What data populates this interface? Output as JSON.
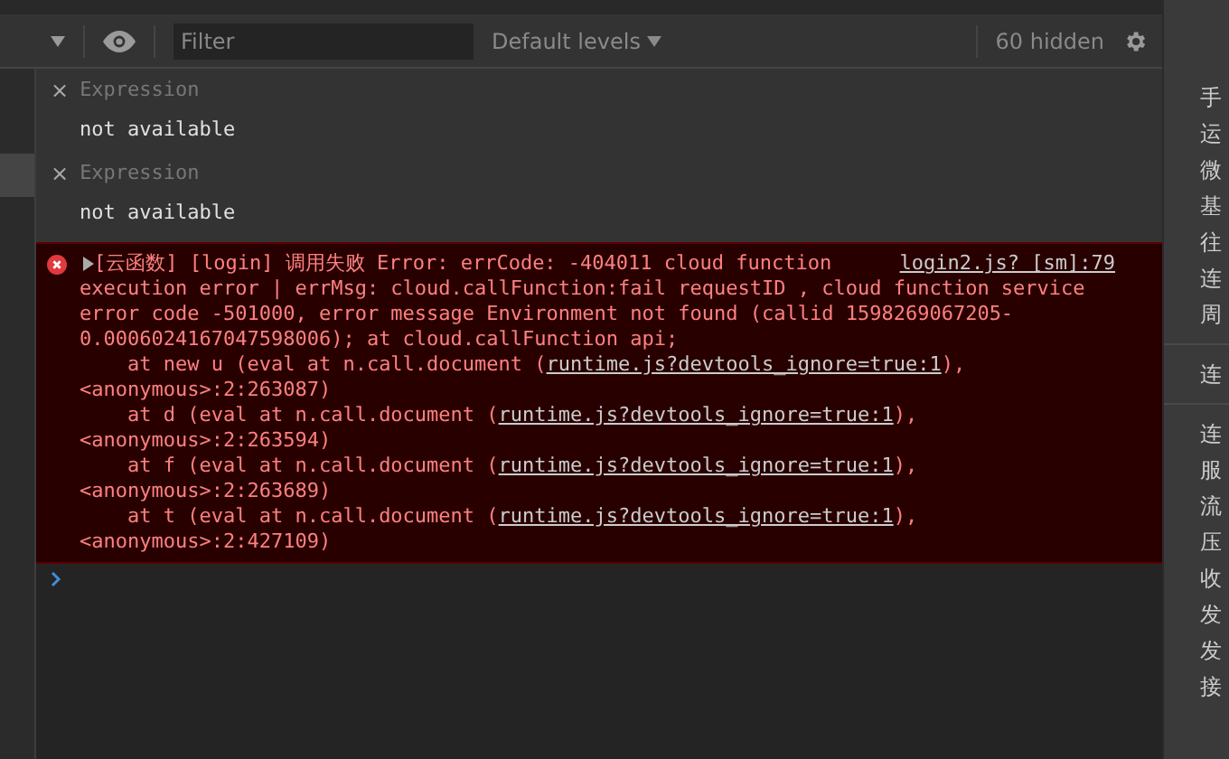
{
  "toolbar": {
    "filter": {
      "placeholder": "Filter"
    },
    "levels": "Default levels",
    "hidden_count": "60 hidden"
  },
  "expressions": [
    {
      "close": "×",
      "label": "Expression",
      "value": "not available"
    },
    {
      "close": "×",
      "label": "Expression",
      "value": "not available"
    }
  ],
  "error": {
    "expanded": false,
    "source": "login2.js? [sm]:79",
    "lines": [
      [
        {
          "text": "[云函数] [login] 调用失败 Error: errCode: -404011 cloud function",
          "link": false
        }
      ],
      [
        {
          "text": "execution error | errMsg: cloud.callFunction:fail requestID , cloud function service",
          "link": false
        }
      ],
      [
        {
          "text": "error code -501000, error message Environment not found (callid 1598269067205-",
          "link": false
        }
      ],
      [
        {
          "text": "0.0006024167047598006); at cloud.callFunction api;",
          "link": false
        }
      ],
      [
        {
          "text": "    at new u (eval at n.call.document (",
          "link": false
        },
        {
          "text": "runtime.js?devtools_ignore=true:1",
          "link": true
        },
        {
          "text": "),",
          "link": false
        }
      ],
      [
        {
          "text": "<anonymous>:2:263087)",
          "link": false
        }
      ],
      [
        {
          "text": "    at d (eval at n.call.document (",
          "link": false
        },
        {
          "text": "runtime.js?devtools_ignore=true:1",
          "link": true
        },
        {
          "text": "),",
          "link": false
        }
      ],
      [
        {
          "text": "<anonymous>:2:263594)",
          "link": false
        }
      ],
      [
        {
          "text": "    at f (eval at n.call.document (",
          "link": false
        },
        {
          "text": "runtime.js?devtools_ignore=true:1",
          "link": true
        },
        {
          "text": "),",
          "link": false
        }
      ],
      [
        {
          "text": "<anonymous>:2:263689)",
          "link": false
        }
      ],
      [
        {
          "text": "    at t (eval at n.call.document (",
          "link": false
        },
        {
          "text": "runtime.js?devtools_ignore=true:1",
          "link": true
        },
        {
          "text": "),",
          "link": false
        }
      ],
      [
        {
          "text": "<anonymous>:2:427109)",
          "link": false
        }
      ]
    ]
  },
  "side_panel": {
    "groups": [
      [
        "手",
        "运",
        "微",
        "基",
        "往",
        "连",
        "周"
      ],
      [
        "连"
      ],
      [
        "连",
        "服",
        "流",
        "压",
        "收",
        "发",
        "发",
        "接"
      ]
    ]
  }
}
